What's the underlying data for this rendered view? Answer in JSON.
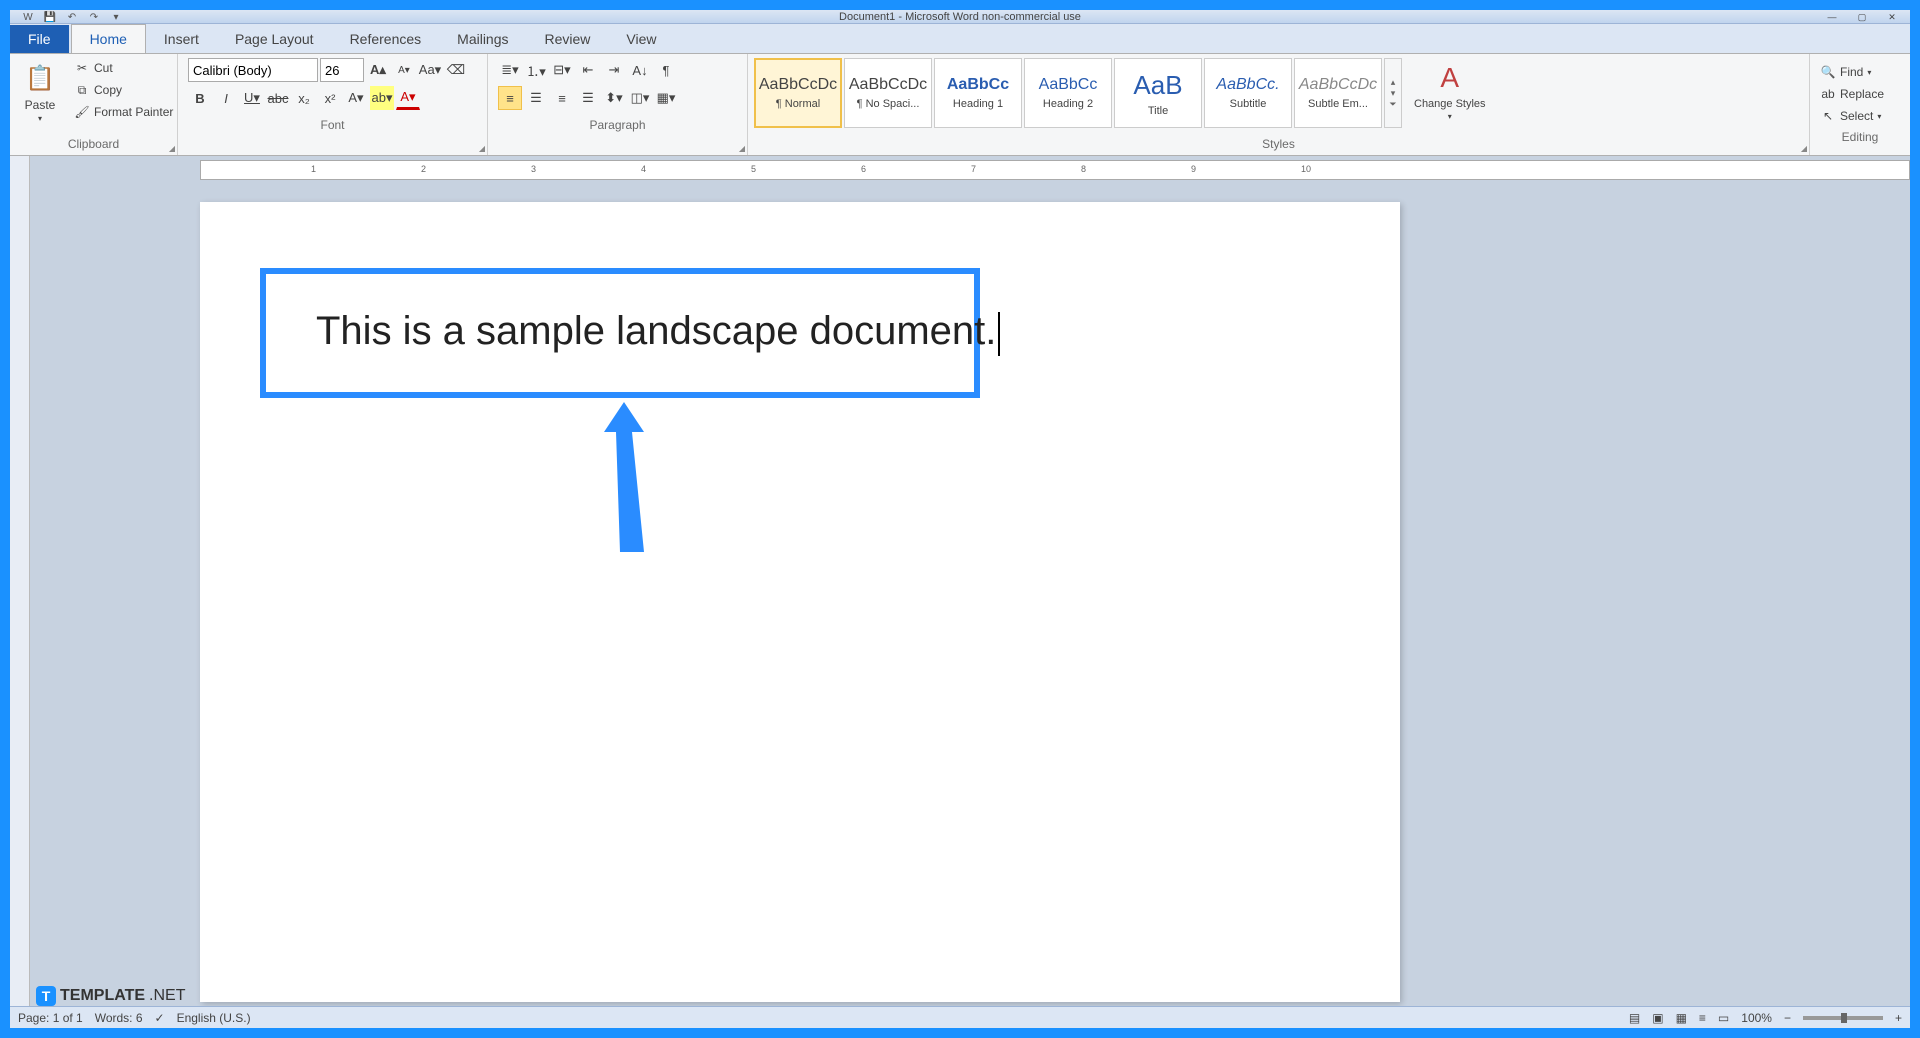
{
  "window": {
    "title": "Document1 - Microsoft Word non-commercial use"
  },
  "tabs": {
    "file": "File",
    "items": [
      "Home",
      "Insert",
      "Page Layout",
      "References",
      "Mailings",
      "Review",
      "View"
    ],
    "active": "Home"
  },
  "clipboard": {
    "paste": "Paste",
    "cut": "Cut",
    "copy": "Copy",
    "format_painter": "Format Painter",
    "label": "Clipboard"
  },
  "font": {
    "name": "Calibri (Body)",
    "size": "26",
    "label": "Font"
  },
  "paragraph": {
    "label": "Paragraph"
  },
  "styles": {
    "label": "Styles",
    "change_styles": "Change Styles",
    "items": [
      {
        "preview": "AaBbCcDc",
        "name": "¶ Normal"
      },
      {
        "preview": "AaBbCcDc",
        "name": "¶ No Spaci..."
      },
      {
        "preview": "AaBbCc",
        "name": "Heading 1"
      },
      {
        "preview": "AaBbCc",
        "name": "Heading 2"
      },
      {
        "preview": "AaB",
        "name": "Title"
      },
      {
        "preview": "AaBbCc.",
        "name": "Subtitle"
      },
      {
        "preview": "AaBbCcDc",
        "name": "Subtle Em..."
      }
    ]
  },
  "editing": {
    "find": "Find",
    "replace": "Replace",
    "select": "Select",
    "label": "Editing"
  },
  "ruler": {
    "numbers": [
      "1",
      "2",
      "3",
      "4",
      "5",
      "6",
      "7",
      "8",
      "9",
      "10"
    ]
  },
  "document": {
    "text": "This is a sample landscape document."
  },
  "status": {
    "page": "Page: 1 of 1",
    "words": "Words: 6",
    "language": "English (U.S.)",
    "zoom": "100%"
  },
  "watermark": {
    "text": "TEMPLATE",
    "suffix": ".NET"
  }
}
